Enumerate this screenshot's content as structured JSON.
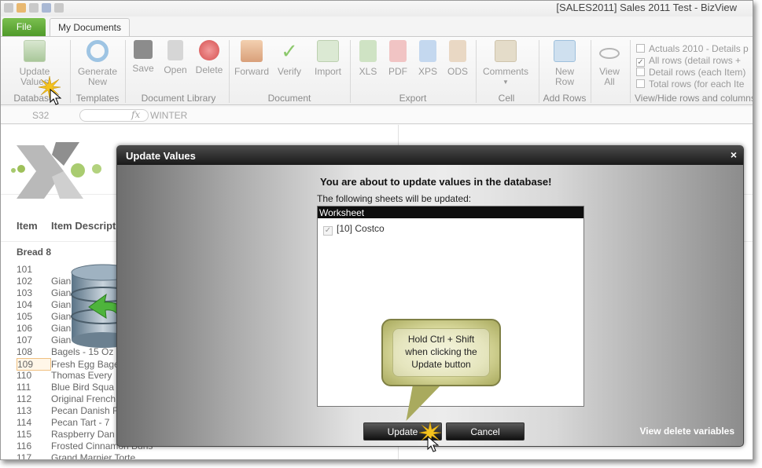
{
  "window": {
    "title": "[SALES2011] Sales 2011 Test - BizView"
  },
  "tabs": {
    "file": "File",
    "my_documents": "My Documents"
  },
  "ribbon": {
    "database": {
      "update_values": "Update Values",
      "group": "Database"
    },
    "templates": {
      "generate_new": "Generate New",
      "group": "Templates"
    },
    "document_library": {
      "save": "Save",
      "open": "Open",
      "delete": "Delete",
      "group": "Document Library"
    },
    "document": {
      "forward": "Forward",
      "verify": "Verify",
      "import": "Import",
      "group": "Document"
    },
    "export": {
      "xls": "XLS",
      "pdf": "PDF",
      "xps": "XPS",
      "ods": "ODS",
      "group": "Export"
    },
    "cell": {
      "comments": "Comments",
      "group": "Cell"
    },
    "add_rows": {
      "new_row": "New Row",
      "group": "Add Rows"
    },
    "view_hide": {
      "view_all": "View All",
      "group": "View/Hide rows and columns",
      "options": [
        {
          "label": "Actuals 2010 - Details p",
          "checked": false
        },
        {
          "label": "All rows (detail rows +",
          "checked": true
        },
        {
          "label": "Detail rows (each Item)",
          "checked": false
        },
        {
          "label": "Total rows (for each Ite",
          "checked": false
        }
      ]
    }
  },
  "formula_bar": {
    "cell_ref": "S32",
    "fx": "fx",
    "value": "WINTER"
  },
  "sheet": {
    "headers": {
      "item": "Item",
      "description": "Item Descript"
    },
    "section": "Bread 8",
    "rows": [
      {
        "num": "101",
        "desc": ""
      },
      {
        "num": "102",
        "desc": "Gian"
      },
      {
        "num": "103",
        "desc": "Gian"
      },
      {
        "num": "104",
        "desc": "Gian"
      },
      {
        "num": "105",
        "desc": "Gian"
      },
      {
        "num": "106",
        "desc": "Gian"
      },
      {
        "num": "107",
        "desc": "Gian"
      },
      {
        "num": "108",
        "desc": "Bagels - 15 Oz"
      },
      {
        "num": "109",
        "desc": "Fresh Egg Bage"
      },
      {
        "num": "110",
        "desc": "Thomas Every"
      },
      {
        "num": "111",
        "desc": "Blue Bird Squa"
      },
      {
        "num": "112",
        "desc": "Original French"
      },
      {
        "num": "113",
        "desc": "Pecan Danish F"
      },
      {
        "num": "114",
        "desc": "Pecan Tart - 7"
      },
      {
        "num": "115",
        "desc": "Raspberry Dan"
      },
      {
        "num": "116",
        "desc": "Frosted Cinnamon Buns"
      },
      {
        "num": "117",
        "desc": "Grand Marnier Torte"
      }
    ]
  },
  "dialog": {
    "title": "Update Values",
    "close": "×",
    "warning": "You are about to update values in the database!",
    "subtext": "The following sheets will be updated:",
    "list_header": "Worksheet",
    "worksheets": [
      {
        "label": "[10] Costco",
        "checked": true
      }
    ],
    "update_button": "Update",
    "cancel_button": "Cancel",
    "link": "View delete variables"
  },
  "callout": {
    "text_line1": "Hold Ctrl + Shift",
    "text_line2": "when clicking the",
    "text_line3": "Update button"
  }
}
